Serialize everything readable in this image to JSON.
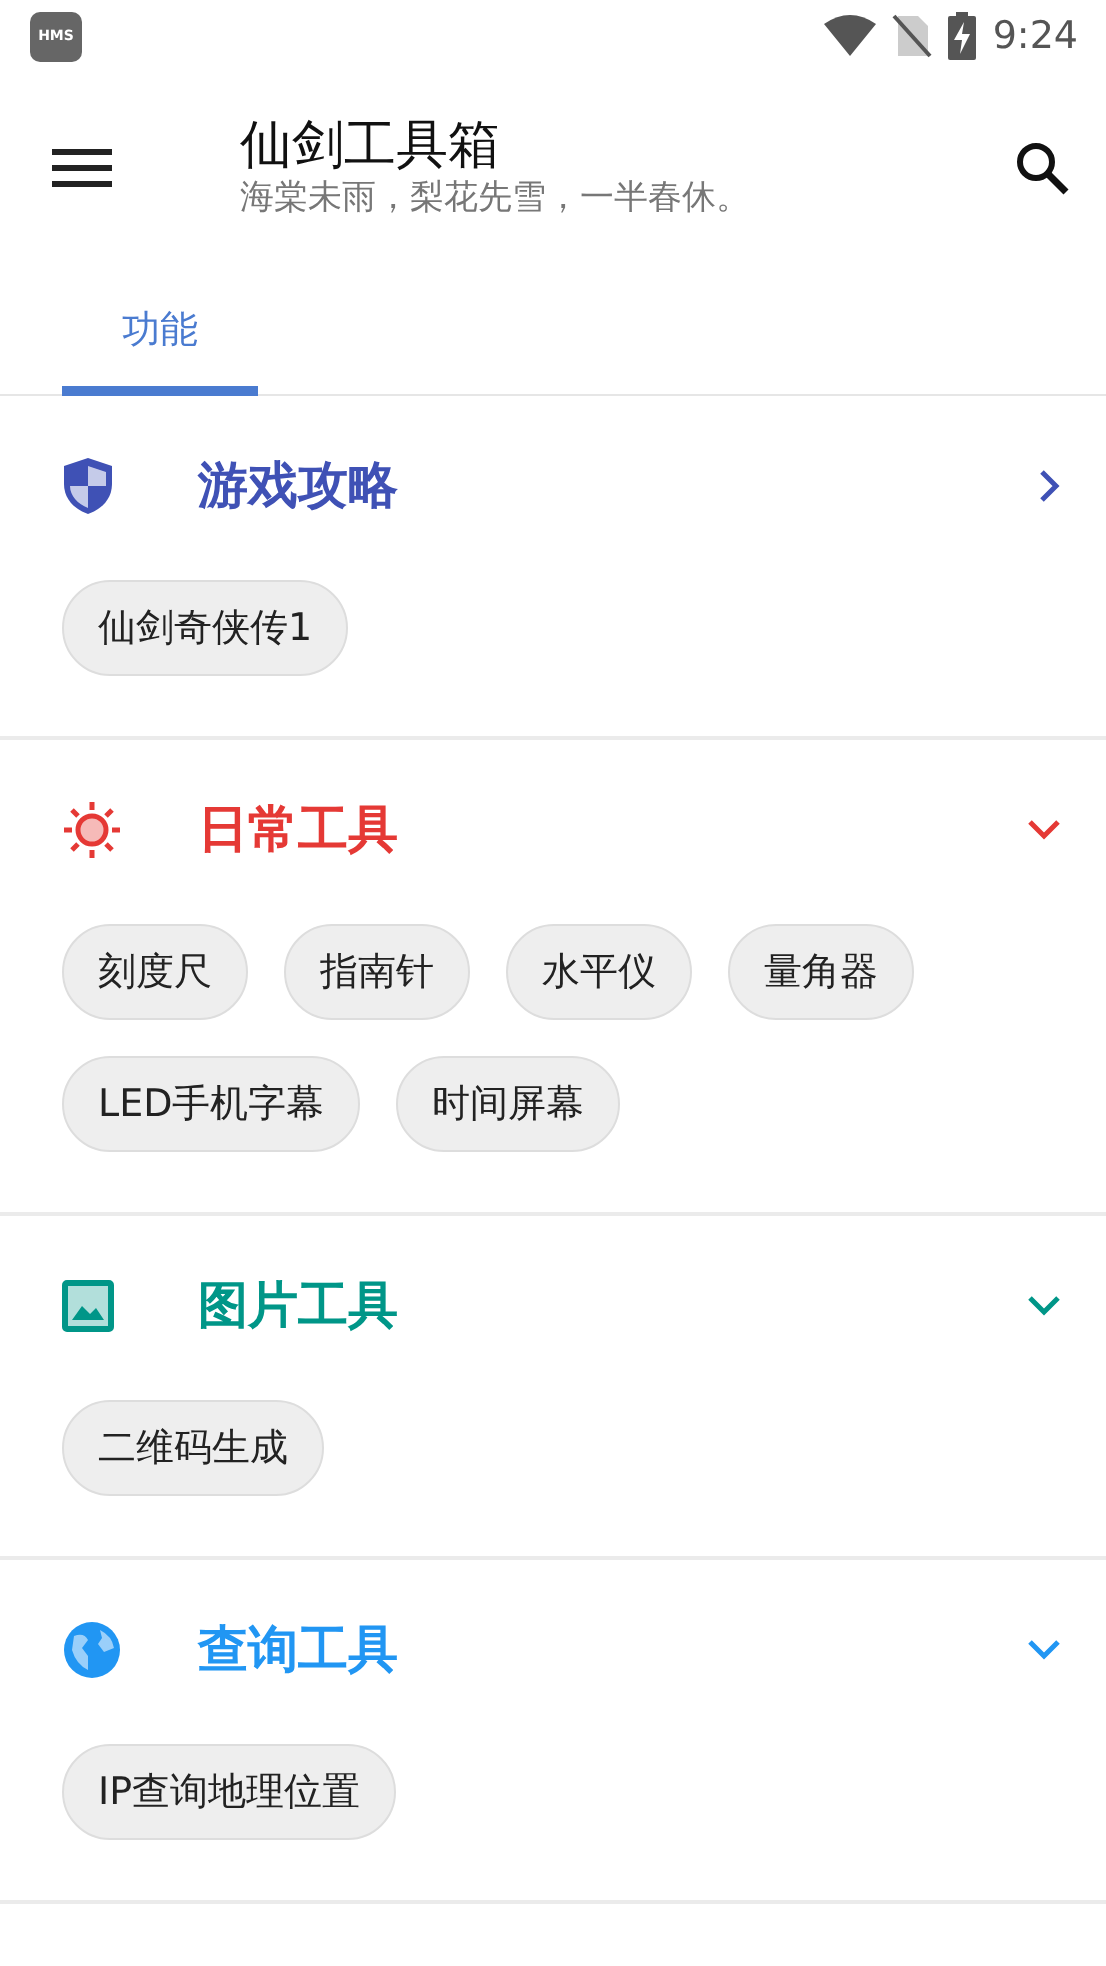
{
  "status_bar": {
    "app_badge": "HMS",
    "time": "9:24"
  },
  "app_bar": {
    "title": "仙剑工具箱",
    "subtitle": "海棠未雨，梨花先雪，一半春休。"
  },
  "tabs": [
    {
      "label": "功能",
      "selected": true
    }
  ],
  "sections": [
    {
      "title": "游戏攻略",
      "color": "#3f51b5",
      "expanded": false,
      "items": [
        "仙剑奇侠传1"
      ]
    },
    {
      "title": "日常工具",
      "color": "#e53935",
      "expanded": true,
      "items": [
        "刻度尺",
        "指南针",
        "水平仪",
        "量角器",
        "LED手机字幕",
        "时间屏幕"
      ]
    },
    {
      "title": "图片工具",
      "color": "#009688",
      "expanded": true,
      "items": [
        "二维码生成"
      ]
    },
    {
      "title": "查询工具",
      "color": "#2196f3",
      "expanded": true,
      "items": [
        "IP查询地理位置"
      ]
    }
  ]
}
